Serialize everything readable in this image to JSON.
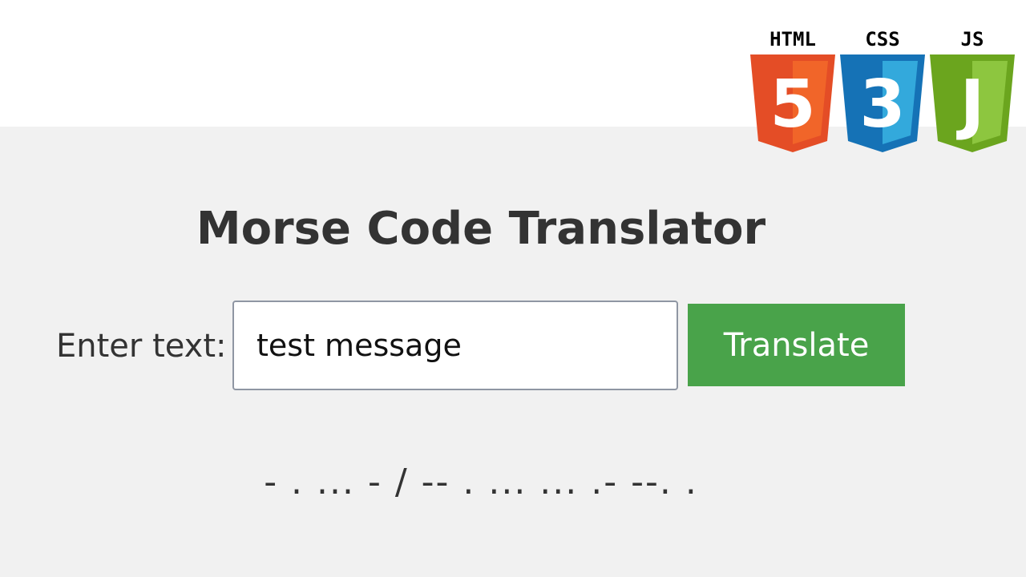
{
  "app": {
    "title": "Morse Code Translator"
  },
  "form": {
    "label": "Enter text:",
    "input_value": "test message",
    "button_label": "Translate"
  },
  "result": {
    "morse": "- . ... - / -- . ... ... .- --. ."
  },
  "badges": [
    {
      "label": "HTML",
      "glyph": "5",
      "icon": "html5-shield-icon",
      "color": "#e44d26"
    },
    {
      "label": "CSS",
      "glyph": "3",
      "icon": "css3-shield-icon",
      "color": "#1572b6"
    },
    {
      "label": "JS",
      "glyph": "J",
      "icon": "js-shield-icon",
      "color": "#6ba51e"
    }
  ]
}
